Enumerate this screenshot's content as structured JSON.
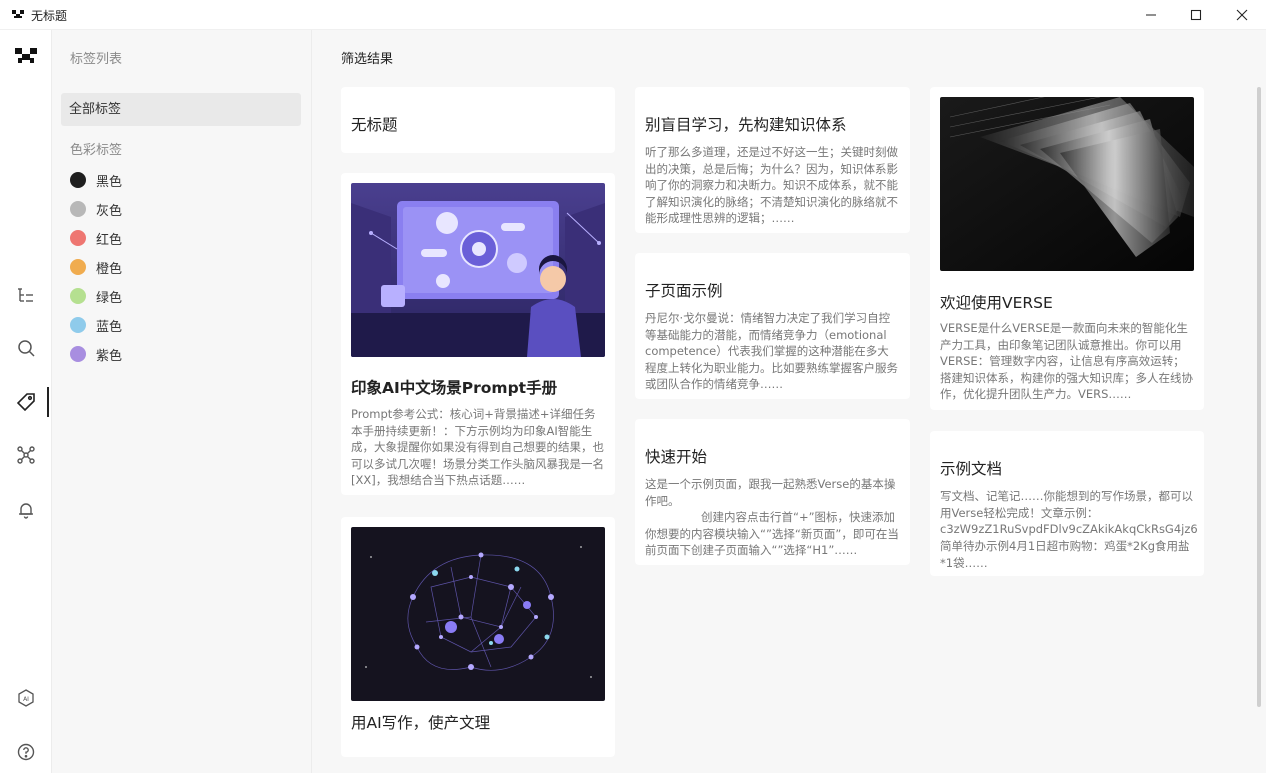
{
  "window": {
    "title": "无标题"
  },
  "rail": {
    "icons": [
      "logo-icon",
      "outline-icon",
      "search-icon",
      "tag-icon",
      "graph-icon",
      "bell-icon",
      "ai-icon",
      "help-icon"
    ]
  },
  "tagbar": {
    "title": "标签列表",
    "all_tags": "全部标签",
    "color_tags_title": "色彩标签",
    "colors": [
      {
        "label": "黑色",
        "color": "#1f1f1f"
      },
      {
        "label": "灰色",
        "color": "#b8b8b8"
      },
      {
        "label": "红色",
        "color": "#ee7671"
      },
      {
        "label": "橙色",
        "color": "#f0ac4f"
      },
      {
        "label": "绿色",
        "color": "#b5e090"
      },
      {
        "label": "蓝色",
        "color": "#8fcbeb"
      },
      {
        "label": "紫色",
        "color": "#a88ee0"
      }
    ]
  },
  "main": {
    "title": "筛选结果",
    "cards": {
      "c1": {
        "title": "无标题"
      },
      "c2": {
        "title": "印象AI中文场景Prompt手册",
        "body": "Prompt参考公式：核心词+背景描述+详细任务本手册持续更新！：下方示例均为印象AI智能生成，大象提醒你如果没有得到自己想要的结果，也可以多试几次喔！场景分类工作头脑风暴我是一名 [XX]，我想结合当下热点话题……"
      },
      "c3": {
        "title": "用AI写作，使产文理"
      },
      "c4": {
        "title": "别盲目学习，先构建知识体系",
        "body": "听了那么多道理，还是过不好这一生；关键时刻做出的决策，总是后悔；为什么？因为，知识体系影响了你的洞察力和决断力。知识不成体系，就不能了解知识演化的脉络；不清楚知识演化的脉络就不能形成理性思辨的逻辑；……"
      },
      "c5": {
        "title": "子页面示例",
        "body": "丹尼尔·戈尔曼说：情绪智力决定了我们学习自控等基础能力的潜能，而情绪竞争力（emotional competence）代表我们掌握的这种潜能在多大程度上转化为职业能力。比如要熟练掌握客户服务或团队合作的情绪竞争……"
      },
      "c6": {
        "title": "快速开始",
        "body1": "这是一个示例页面，跟我一起熟悉Verse的基本操作吧。",
        "body2": "创建内容点击行首“+”图标，快速添加你想要的内容模块输入“”选择“新页面”，即可在当前页面下创建子页面输入“”选择“H1”……"
      },
      "c7": {
        "title": "欢迎使用VERSE",
        "body": "VERSE是什么VERSE是一款面向未来的智能化生产力工具，由印象笔记团队诚意推出。你可以用VERSE：管理数字内容，让信息有序高效运转；搭建知识体系，构建你的强大知识库；多人在线协作，优化提升团队生产力。VERS……"
      },
      "c8": {
        "title": "示例文档",
        "body1": "写文档、记笔记……你能想到的写作场景，都可以用Verse轻松完成！文章示例：",
        "body2": "c3zW9zZ1RuSvpdFDlv9cZAkikAkqCkRsG4jz6",
        "body3": "简单待办示例4月1日超市购物：鸡蛋*2Kg食用盐*1袋……"
      }
    }
  }
}
